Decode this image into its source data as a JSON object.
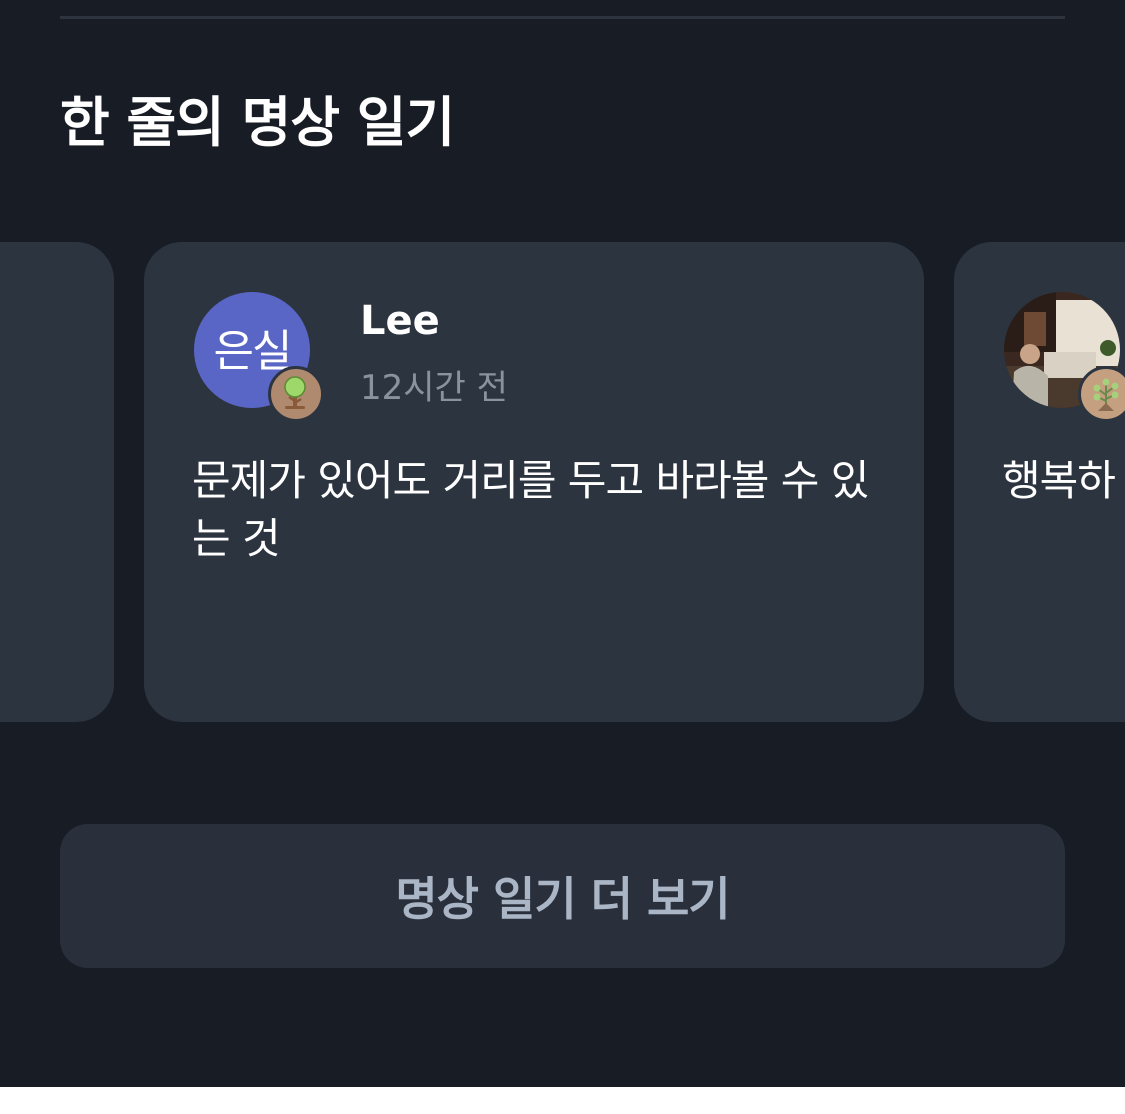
{
  "section": {
    "title": "한 줄의 명상 일기"
  },
  "cards": {
    "main": {
      "avatar_text": "은실",
      "avatar_color": "#5a66c6",
      "badge_icon": "tree-icon",
      "user_name": "Lee",
      "time": "12시간 전",
      "body": "문제가 있어도 거리를 두고 바라볼 수 있는 것"
    },
    "next": {
      "avatar_type": "photo",
      "badge_icon": "tree-icon",
      "body": "행복하"
    }
  },
  "more_button": {
    "label": "명상 일기 더 보기"
  },
  "colors": {
    "background": "#181d25",
    "card": "#2c3440",
    "button": "#2a303b",
    "button_text": "#aab5c6",
    "muted_text": "#8a929e"
  }
}
